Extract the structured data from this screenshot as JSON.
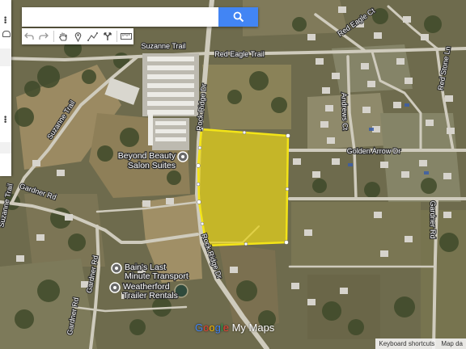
{
  "search": {
    "placeholder": "",
    "value": ""
  },
  "toolbar": {
    "tools": [
      "undo-icon",
      "redo-icon",
      "hand-icon",
      "marker-icon",
      "draw-line-icon",
      "route-icon",
      "ruler-icon"
    ]
  },
  "roads": {
    "suzanne_top": "Suzanne Trail",
    "red_eagle_trail": "Red Eagle Trail",
    "red_eagle_ct": "Red Eagle Ct",
    "red_stone": "Red Stone Ln",
    "andrews": "Andrews Ct",
    "golden_arrow": "Golden Arrow Dr",
    "rock_ridge_top": "Rock Ridge Dr",
    "rock_ridge_bottom": "Rock Ridge Dr",
    "suzanne_diag": "Suzanne Trail",
    "gardner_rd": "Gardner Rd",
    "suzanne_left": "Suzanne Trail",
    "gardner_rd_mid": "Gardner Rd",
    "gardner_rd_low": "Gardner Rd",
    "gardner_rd_right": "Gardner Rd"
  },
  "places": {
    "beyond_beauty_1": "Beyond Beauty",
    "beyond_beauty_2": "Salon Suites",
    "bains_1": "Bain's Last",
    "bains_2": "Minute Transport",
    "weatherford_1": "Weatherford",
    "weatherford_2": "Trailer Rentals"
  },
  "polygon": {
    "fill_color": "#e8d21a",
    "stroke_color": "#f3e418"
  },
  "brand": {
    "google": "Google",
    "mymaps": " My Maps"
  },
  "footer": {
    "keyboard_shortcuts": "Keyboard shortcuts",
    "map_data": "Map da"
  }
}
